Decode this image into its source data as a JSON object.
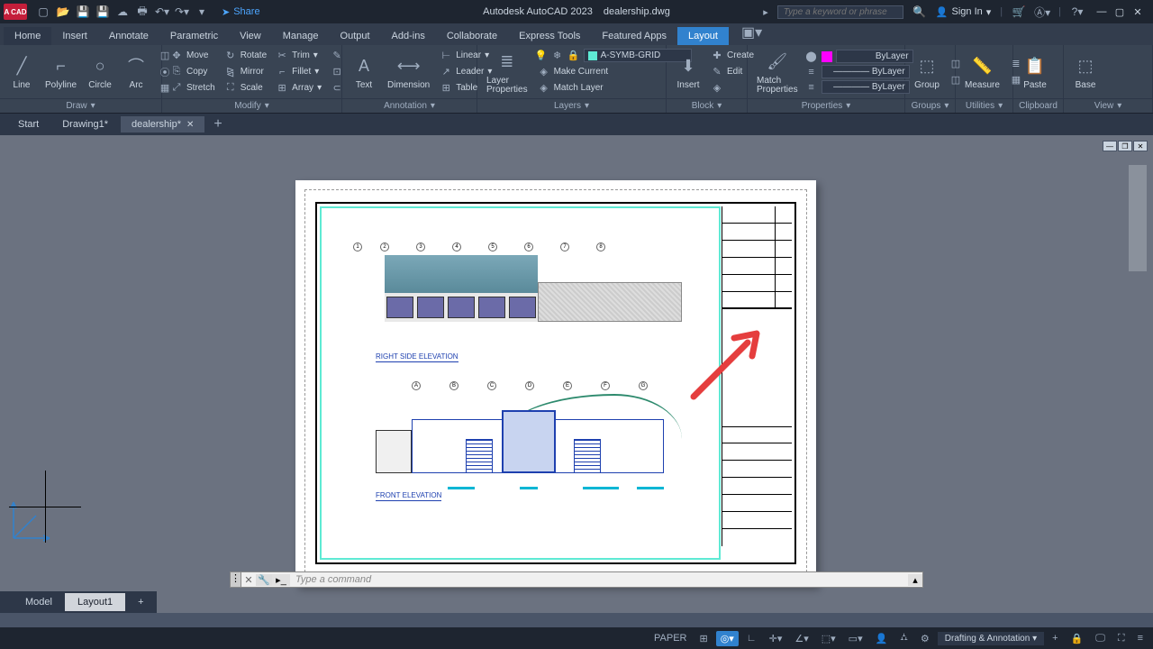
{
  "app": {
    "name": "Autodesk AutoCAD 2023",
    "file": "dealership.dwg",
    "badge": "A CAD"
  },
  "titlebar": {
    "share": "Share",
    "search_placeholder": "Type a keyword or phrase",
    "signin": "Sign In"
  },
  "menu": {
    "items": [
      "Home",
      "Insert",
      "Annotate",
      "Parametric",
      "View",
      "Manage",
      "Output",
      "Add-ins",
      "Collaborate",
      "Express Tools",
      "Featured Apps",
      "Layout"
    ]
  },
  "ribbon": {
    "draw": {
      "title": "Draw",
      "line": "Line",
      "polyline": "Polyline",
      "circle": "Circle",
      "arc": "Arc"
    },
    "modify": {
      "title": "Modify",
      "move": "Move",
      "copy": "Copy",
      "stretch": "Stretch",
      "rotate": "Rotate",
      "mirror": "Mirror",
      "scale": "Scale",
      "trim": "Trim",
      "fillet": "Fillet",
      "array": "Array"
    },
    "annotation": {
      "title": "Annotation",
      "text": "Text",
      "dimension": "Dimension",
      "linear": "Linear",
      "leader": "Leader",
      "table": "Table"
    },
    "layers": {
      "title": "Layers",
      "props": "Layer\nProperties",
      "current_layer": "A-SYMB-GRID",
      "make_current": "Make Current",
      "match": "Match Layer"
    },
    "block": {
      "title": "Block",
      "insert": "Insert",
      "create": "Create",
      "edit": "Edit"
    },
    "properties": {
      "title": "Properties",
      "match": "Match\nProperties",
      "bylayer": "ByLayer"
    },
    "groups": {
      "title": "Groups",
      "group": "Group"
    },
    "utilities": {
      "title": "Utilities",
      "measure": "Measure"
    },
    "clipboard": {
      "title": "Clipboard",
      "paste": "Paste"
    },
    "view": {
      "title": "View",
      "base": "Base"
    }
  },
  "filetabs": {
    "start": "Start",
    "tabs": [
      "Drawing1*",
      "dealership*"
    ]
  },
  "drawing": {
    "elev1_title": "RIGHT SIDE ELEVATION",
    "elev2_title": "FRONT ELEVATION"
  },
  "command": {
    "placeholder": "Type a command"
  },
  "layout_tabs": {
    "model": "Model",
    "layout1": "Layout1"
  },
  "status": {
    "space": "PAPER",
    "workspace": "Drafting & Annotation"
  }
}
